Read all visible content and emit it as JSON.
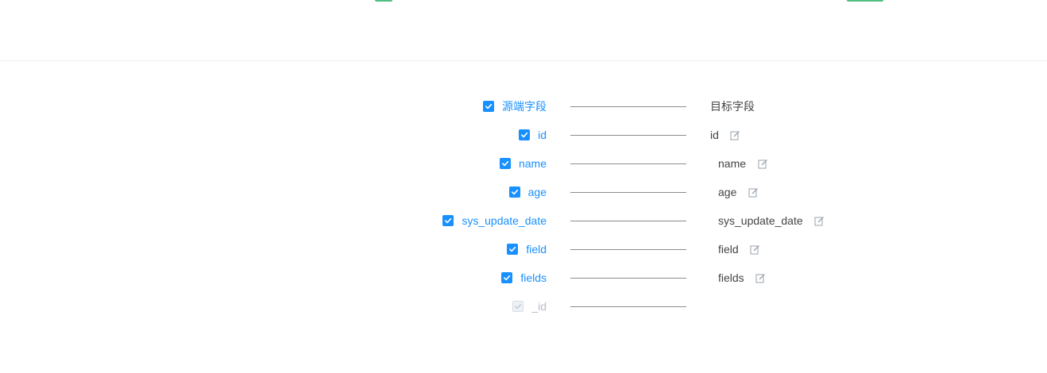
{
  "header": {
    "accent_color": "#2fb36b"
  },
  "mapping": {
    "source_header": "源端字段",
    "target_header": "目标字段",
    "rows": [
      {
        "source": "id",
        "target": "id",
        "checked": true,
        "disabled": false
      },
      {
        "source": "name",
        "target": "name",
        "checked": true,
        "disabled": false
      },
      {
        "source": "age",
        "target": "age",
        "checked": true,
        "disabled": false
      },
      {
        "source": "sys_update_date",
        "target": "sys_update_date",
        "checked": true,
        "disabled": false
      },
      {
        "source": "field",
        "target": "field",
        "checked": true,
        "disabled": false
      },
      {
        "source": "fields",
        "target": "fields",
        "checked": true,
        "disabled": false
      },
      {
        "source": "_id",
        "target": "",
        "checked": true,
        "disabled": true
      }
    ]
  },
  "colors": {
    "primary": "#1890ff",
    "connector": "#8c8c8c",
    "disabled_text": "#b6bcc7"
  },
  "icons": {
    "check": "check-icon",
    "edit": "edit-icon"
  }
}
